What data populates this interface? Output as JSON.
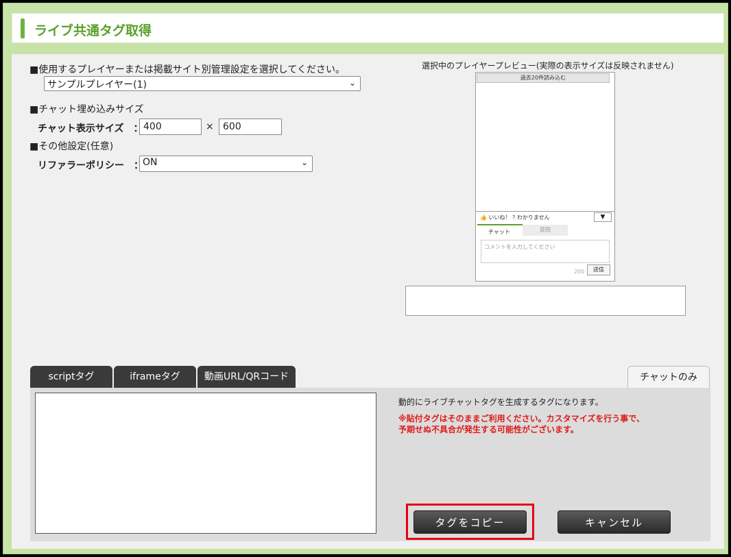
{
  "header": {
    "title": "ライブ共通タグ取得"
  },
  "settings": {
    "player_section_label": "■使用するプレイヤーまたは掲載サイト別管理設定を選択してください。",
    "player_select_value": "サンプルプレイヤー(1)",
    "chat_size_section_label": "■チャット埋め込みサイズ",
    "chat_size_label": "チャット表示サイズ　：",
    "width_value": "400",
    "times_sign": "×",
    "height_value": "600",
    "other_section_label": "■その他設定(任意)",
    "referrer_label": "リファラーポリシー　：",
    "referrer_value": "ON"
  },
  "preview": {
    "caption": "選択中のプレイヤープレビュー(実際の表示サイズは反映されません)",
    "load_more": "過去20件読み込む",
    "like": "いいね！",
    "dont_understand": "わかりません",
    "tab_chat": "チャット",
    "tab_question": "質問",
    "comment_placeholder": "コメントを入力してください",
    "char_count": "200",
    "send": "送信",
    "dropdown_arrow": "▼"
  },
  "tabs": [
    {
      "label": "scriptタグ"
    },
    {
      "label": "iframeタグ"
    },
    {
      "label": "動画URL/QRコード"
    }
  ],
  "right_tab": {
    "label": "チャットのみ"
  },
  "panel": {
    "description": "動的にライブチャットタグを生成するタグになります。",
    "warning_line1": "※貼付タグはそのままご利用ください。カスタマイズを行う事で、",
    "warning_line2": "予期せぬ不具合が発生する可能性がございます。"
  },
  "buttons": {
    "copy": "タグをコピー",
    "cancel": "キャンセル"
  },
  "colors": {
    "accent_green": "#6db33f",
    "frame_green": "#c8e3a8",
    "warning_red": "#e01a1a",
    "highlight_red": "#e60012"
  }
}
